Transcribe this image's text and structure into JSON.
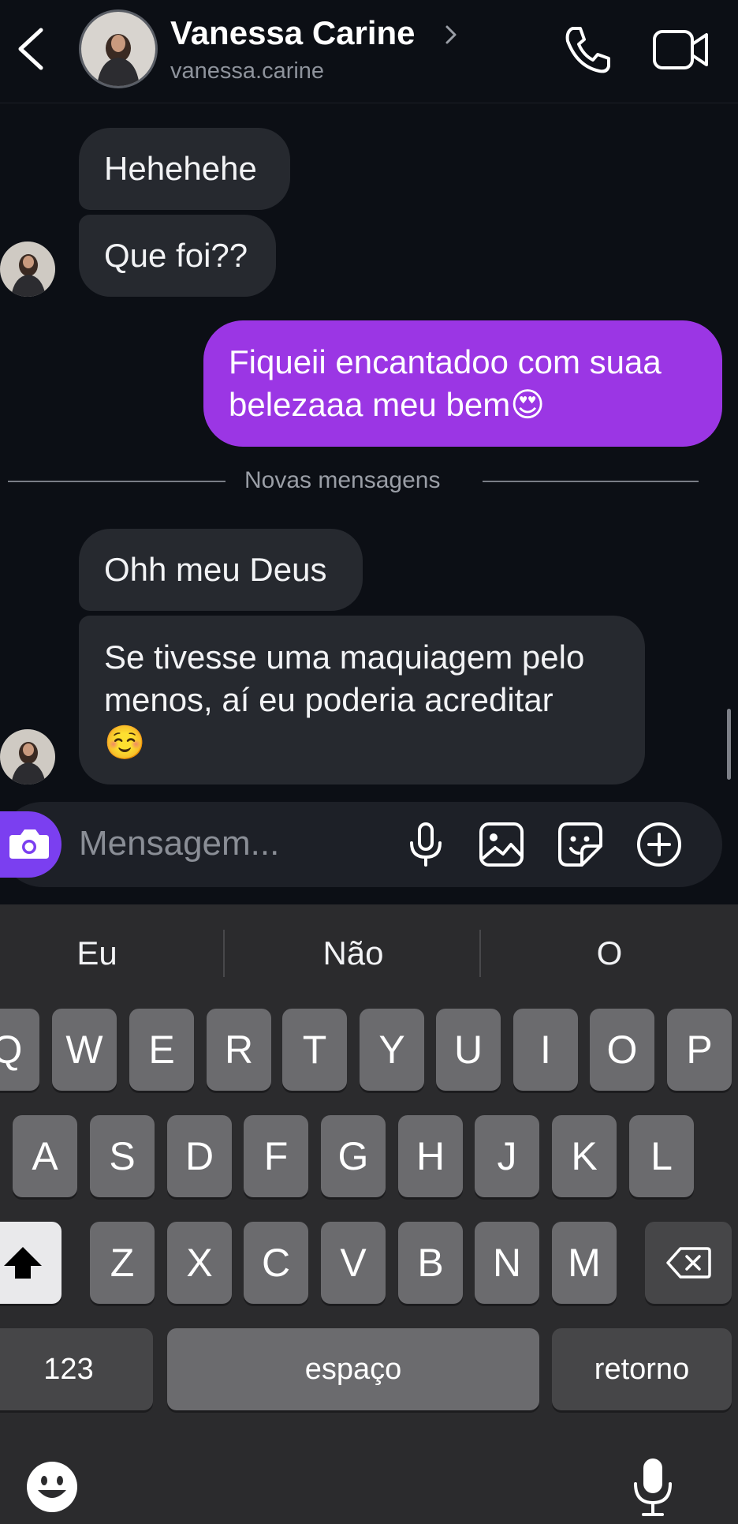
{
  "header": {
    "contact_name": "Vanessa Carine",
    "username": "vanessa.carine",
    "icons": [
      "back-arrow-icon",
      "chevron-right-icon",
      "phone-icon",
      "video-camera-icon"
    ]
  },
  "messages": [
    {
      "direction": "incoming",
      "text": "Hehehehe"
    },
    {
      "direction": "incoming",
      "text": "Que foi??"
    },
    {
      "direction": "outgoing",
      "line1": "Fiqueii encantadoo com suaa",
      "line2": "belezaaa meu bem😍"
    },
    {
      "direction": "incoming",
      "text": "Ohh meu Deus"
    },
    {
      "direction": "incoming",
      "line1": "Se tivesse uma maquiagem pelo",
      "line2": "menos, aí eu poderia acreditar",
      "line3": "☺️"
    }
  ],
  "divider": {
    "label": "Novas mensagens"
  },
  "composer": {
    "placeholder": "Mensagem...",
    "icons": [
      "camera-icon",
      "microphone-icon",
      "gallery-icon",
      "sticker-icon",
      "plus-circle-icon"
    ]
  },
  "keyboard": {
    "suggestions": [
      "Eu",
      "Não",
      "O"
    ],
    "row1": [
      "Q",
      "W",
      "E",
      "R",
      "T",
      "Y",
      "U",
      "I",
      "O",
      "P"
    ],
    "row2": [
      "A",
      "S",
      "D",
      "F",
      "G",
      "H",
      "J",
      "K",
      "L"
    ],
    "row3": [
      "Z",
      "X",
      "C",
      "V",
      "B",
      "N",
      "M"
    ],
    "numbers_label": "123",
    "space_label": "espaço",
    "return_label": "retorno",
    "icons": [
      "shift-icon",
      "backspace-icon",
      "emoji-icon",
      "dictation-microphone-icon"
    ]
  },
  "colors": {
    "background": "#0c0f15",
    "incoming_bubble": "#26292f",
    "outgoing_bubble": "#9b36e4",
    "camera_button": "#7b3ff0",
    "keyboard": "#2b2b2d"
  }
}
